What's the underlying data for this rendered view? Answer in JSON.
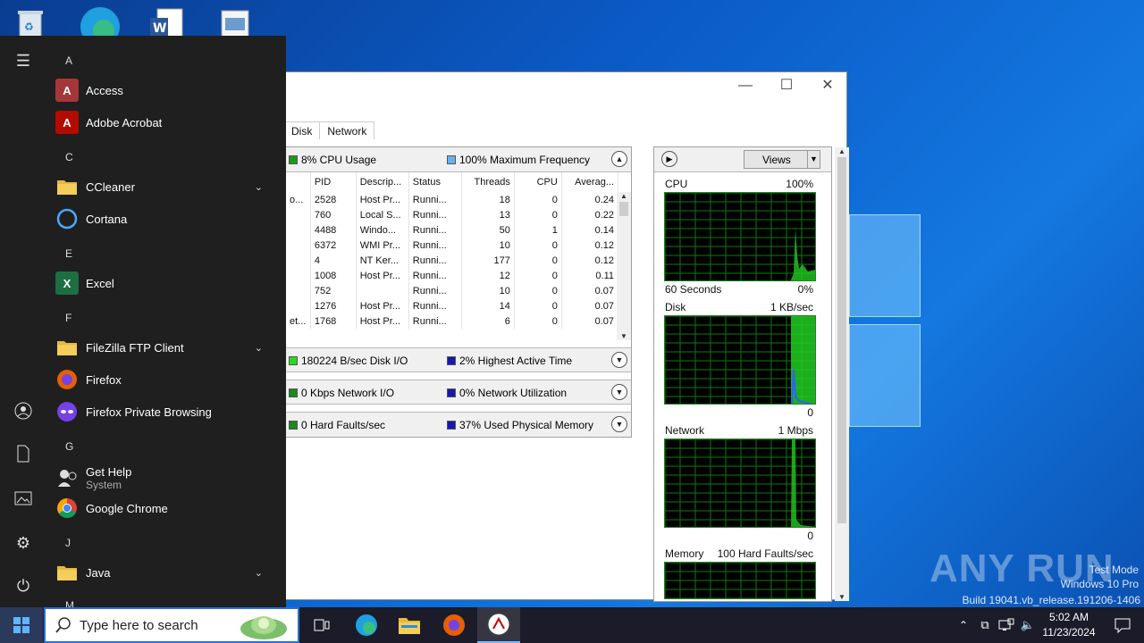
{
  "desktop": {
    "icons": [
      "recycle-bin-icon",
      "edge-icon",
      "word-doc-icon",
      "image-file-icon"
    ]
  },
  "task_manager": {
    "tabs": [
      "y",
      "Disk",
      "Network"
    ],
    "cpu_header": {
      "left": "8% CPU Usage",
      "right": "100% Maximum Frequency"
    },
    "columns": [
      "PID",
      "Descrip...",
      "Status",
      "Threads",
      "CPU",
      "Averag..."
    ],
    "rows": [
      {
        "name": "o...",
        "pid": "2528",
        "desc": "Host Pr...",
        "status": "Runni...",
        "threads": "18",
        "cpu": "0",
        "avg": "0.24"
      },
      {
        "name": "",
        "pid": "760",
        "desc": "Local S...",
        "status": "Runni...",
        "threads": "13",
        "cpu": "0",
        "avg": "0.22"
      },
      {
        "name": "",
        "pid": "4488",
        "desc": "Windo...",
        "status": "Runni...",
        "threads": "50",
        "cpu": "1",
        "avg": "0.14"
      },
      {
        "name": "",
        "pid": "6372",
        "desc": "WMI Pr...",
        "status": "Runni...",
        "threads": "10",
        "cpu": "0",
        "avg": "0.12"
      },
      {
        "name": "",
        "pid": "4",
        "desc": "NT Ker...",
        "status": "Runni...",
        "threads": "177",
        "cpu": "0",
        "avg": "0.12"
      },
      {
        "name": "",
        "pid": "1008",
        "desc": "Host Pr...",
        "status": "Runni...",
        "threads": "12",
        "cpu": "0",
        "avg": "0.11"
      },
      {
        "name": "",
        "pid": "752",
        "desc": "",
        "status": "Runni...",
        "threads": "10",
        "cpu": "0",
        "avg": "0.07"
      },
      {
        "name": "",
        "pid": "1276",
        "desc": "Host Pr...",
        "status": "Runni...",
        "threads": "14",
        "cpu": "0",
        "avg": "0.07"
      },
      {
        "name": "et...",
        "pid": "1768",
        "desc": "Host Pr...",
        "status": "Runni...",
        "threads": "6",
        "cpu": "0",
        "avg": "0.07"
      }
    ],
    "disk_header": {
      "left": "180224 B/sec Disk I/O",
      "right": "2% Highest Active Time"
    },
    "network_header": {
      "left": "0 Kbps Network I/O",
      "right": "0% Network Utilization"
    },
    "memory_header": {
      "left": "0 Hard Faults/sec",
      "right": "37% Used Physical Memory"
    },
    "views_label": "Views",
    "graphs": [
      {
        "title": "CPU",
        "max": "100%",
        "footer_left": "60 Seconds",
        "footer_right": "0%"
      },
      {
        "title": "Disk",
        "max": "1 KB/sec",
        "footer_left": "",
        "footer_right": "0"
      },
      {
        "title": "Network",
        "max": "1 Mbps",
        "footer_left": "",
        "footer_right": "0"
      },
      {
        "title": "Memory",
        "max": "100 Hard Faults/sec",
        "footer_left": "",
        "footer_right": ""
      }
    ]
  },
  "start_menu": {
    "letters": [
      "A",
      "C",
      "E",
      "F",
      "G",
      "J",
      "M"
    ],
    "apps": [
      {
        "name": "Access",
        "icon": "access-icon",
        "color": "#a4373a",
        "glyph": "A"
      },
      {
        "name": "Adobe Acrobat",
        "icon": "acrobat-icon",
        "color": "#b30b00",
        "glyph": "A"
      },
      {
        "name": "CCleaner",
        "icon": "folder-icon",
        "color": "#e8b93a",
        "glyph": ""
      },
      {
        "name": "Cortana",
        "icon": "cortana-icon",
        "color": "#1f1f1f",
        "glyph": ""
      },
      {
        "name": "Excel",
        "icon": "excel-icon",
        "color": "#1d6f42",
        "glyph": "X"
      },
      {
        "name": "FileZilla FTP Client",
        "icon": "folder-icon",
        "color": "#e8b93a",
        "glyph": ""
      },
      {
        "name": "Firefox",
        "icon": "firefox-icon",
        "color": "#e66000",
        "glyph": ""
      },
      {
        "name": "Firefox Private Browsing",
        "icon": "firefox-private-icon",
        "color": "#7542e5",
        "glyph": ""
      },
      {
        "name": "Get Help",
        "sub": "System",
        "icon": "get-help-icon",
        "color": "#1f1f1f",
        "glyph": ""
      },
      {
        "name": "Google Chrome",
        "icon": "chrome-icon",
        "color": "#1f1f1f",
        "glyph": ""
      },
      {
        "name": "Java",
        "icon": "folder-icon",
        "color": "#e8b93a",
        "glyph": ""
      }
    ]
  },
  "taskbar": {
    "search_placeholder": "Type here to search",
    "time": "5:02 AM",
    "date": "11/23/2024"
  },
  "watermark": {
    "brand": "ANY RUN",
    "line1": "Test Mode",
    "line2": "Windows 10 Pro",
    "line3": "Build 19041.vb_release.191206-1406"
  }
}
